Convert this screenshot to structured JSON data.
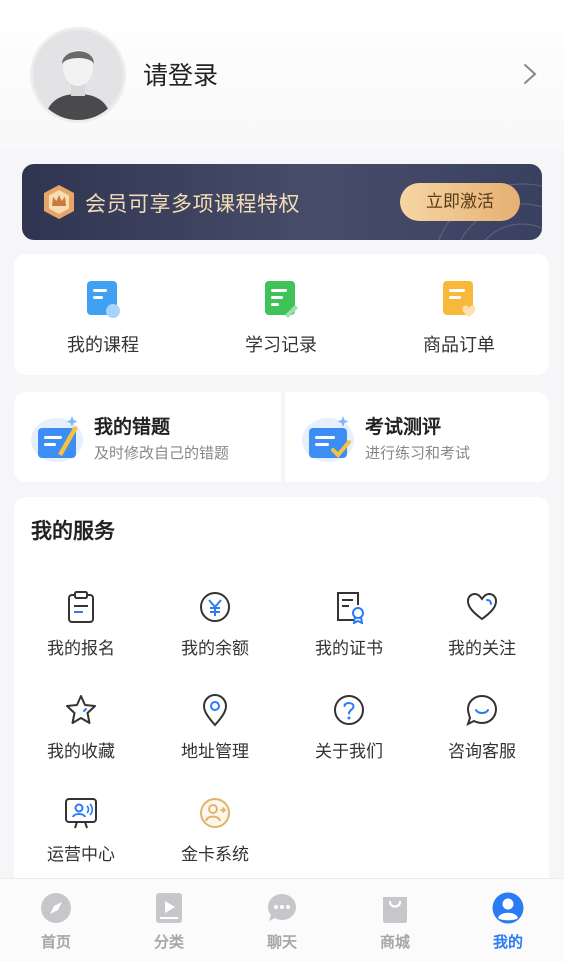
{
  "profile": {
    "login_text": "请登录"
  },
  "vip": {
    "text": "会员可享多项课程特权",
    "button": "立即激活"
  },
  "quick": [
    {
      "label": "我的课程",
      "icon": "course-icon"
    },
    {
      "label": "学习记录",
      "icon": "study-record-icon"
    },
    {
      "label": "商品订单",
      "icon": "order-icon"
    }
  ],
  "twin": [
    {
      "title": "我的错题",
      "subtitle": "及时修改自己的错题"
    },
    {
      "title": "考试测评",
      "subtitle": "进行练习和考试"
    }
  ],
  "services": {
    "title": "我的服务",
    "items": [
      {
        "label": "我的报名",
        "icon": "clipboard-icon"
      },
      {
        "label": "我的余额",
        "icon": "yuan-coin-icon"
      },
      {
        "label": "我的证书",
        "icon": "certificate-icon"
      },
      {
        "label": "我的关注",
        "icon": "heart-icon"
      },
      {
        "label": "我的收藏",
        "icon": "star-icon"
      },
      {
        "label": "地址管理",
        "icon": "location-pin-icon"
      },
      {
        "label": "关于我们",
        "icon": "question-icon"
      },
      {
        "label": "咨询客服",
        "icon": "customer-service-icon"
      },
      {
        "label": "运营中心",
        "icon": "operations-icon"
      },
      {
        "label": "金卡系统",
        "icon": "gold-card-icon"
      }
    ]
  },
  "tabs": [
    {
      "label": "首页",
      "icon": "compass-icon"
    },
    {
      "label": "分类",
      "icon": "category-icon"
    },
    {
      "label": "聊天",
      "icon": "chat-icon"
    },
    {
      "label": "商城",
      "icon": "shopping-bag-icon"
    },
    {
      "label": "我的",
      "icon": "person-icon",
      "active": true
    }
  ],
  "colors": {
    "accent": "#2a7bf4",
    "vip_bg": "#3a4060",
    "vip_text": "#f3dcb6",
    "vip_button": "#edc08a"
  }
}
